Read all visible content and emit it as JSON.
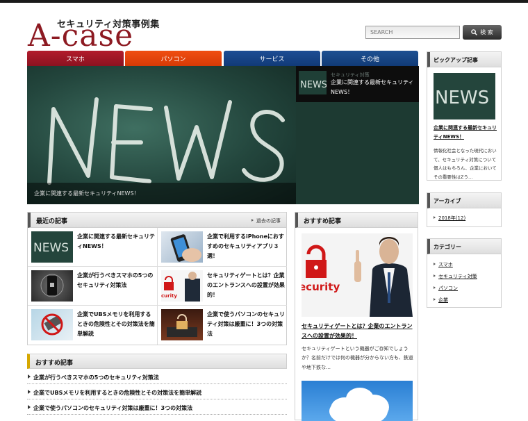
{
  "header": {
    "tagline": "セキュリティ対策事例集",
    "logo": "A-case",
    "search_placeholder": "SEARCH",
    "search_button": "検 索"
  },
  "nav": [
    {
      "label": "スマホ",
      "color": "#a8182a"
    },
    {
      "label": "パソコン",
      "color": "#e8460c"
    },
    {
      "label": "サービス",
      "color": "#184686"
    },
    {
      "label": "その他",
      "color": "#184686"
    }
  ],
  "slider": {
    "caption": "企業に関連する最新セキュリティNEWS！",
    "side": {
      "category": "セキュリティ対策",
      "title": "企業に関連する最新セキュリティNEWS！"
    }
  },
  "recent": {
    "heading": "最近の記事",
    "more_link": "過去の記事",
    "items": [
      {
        "title": "企業に関連する最新セキュリティNEWS！"
      },
      {
        "title": "企業で利用するiPhoneにおすすめのセキュリティアプリ３選！"
      },
      {
        "title": "企業が行うべきスマホの5つのセキュリティ対策法"
      },
      {
        "title": "セキュリティゲートとは？企業のエントランスへの設置が効果的！"
      },
      {
        "title": "企業でUBSメモリを利用するときの危険性とその対策法を簡単解説"
      },
      {
        "title": "企業で使うパソコンのセキュリティ対策は厳重に！3つの対策法"
      }
    ]
  },
  "osusume_big": {
    "heading": "おすすめ記事",
    "title": "セキュリティゲートとは？企業のエントランスへの設置が効果的！",
    "description": "セキュリティゲートという機器がご存知でしょうか？名前だけでは何の機器が分からない方も、鉄道や地下鉄な…",
    "image_text": "ecurity"
  },
  "osusume_list": {
    "heading": "おすすめ記事",
    "items": [
      {
        "title": "企業が行うべきスマホの5つのセキュリティ対策法"
      },
      {
        "title": "企業でUBSメモリを利用するときの危険性とその対策法を簡単解説"
      },
      {
        "title": "企業で使うパソコンのセキュリティ対策は厳重に！3つの対策法"
      }
    ]
  },
  "pickup": {
    "heading": "ピックアップ記事",
    "title": "企業に関連する最新セキュリティNEWS！",
    "description": "情報化社会となった現代において、セキュリティ対策について個人はもちろん、企業においてその重要性はZう…"
  },
  "archive": {
    "heading": "アーカイブ",
    "items": [
      {
        "label": "2018年(12)"
      }
    ]
  },
  "category": {
    "heading": "カテゴリー",
    "items": [
      {
        "label": "スマホ"
      },
      {
        "label": "セキュリティ対策"
      },
      {
        "label": "パソコン"
      },
      {
        "label": "企業"
      }
    ]
  },
  "thumb_text": {
    "news": "NEWS",
    "lock_text": "curity"
  }
}
